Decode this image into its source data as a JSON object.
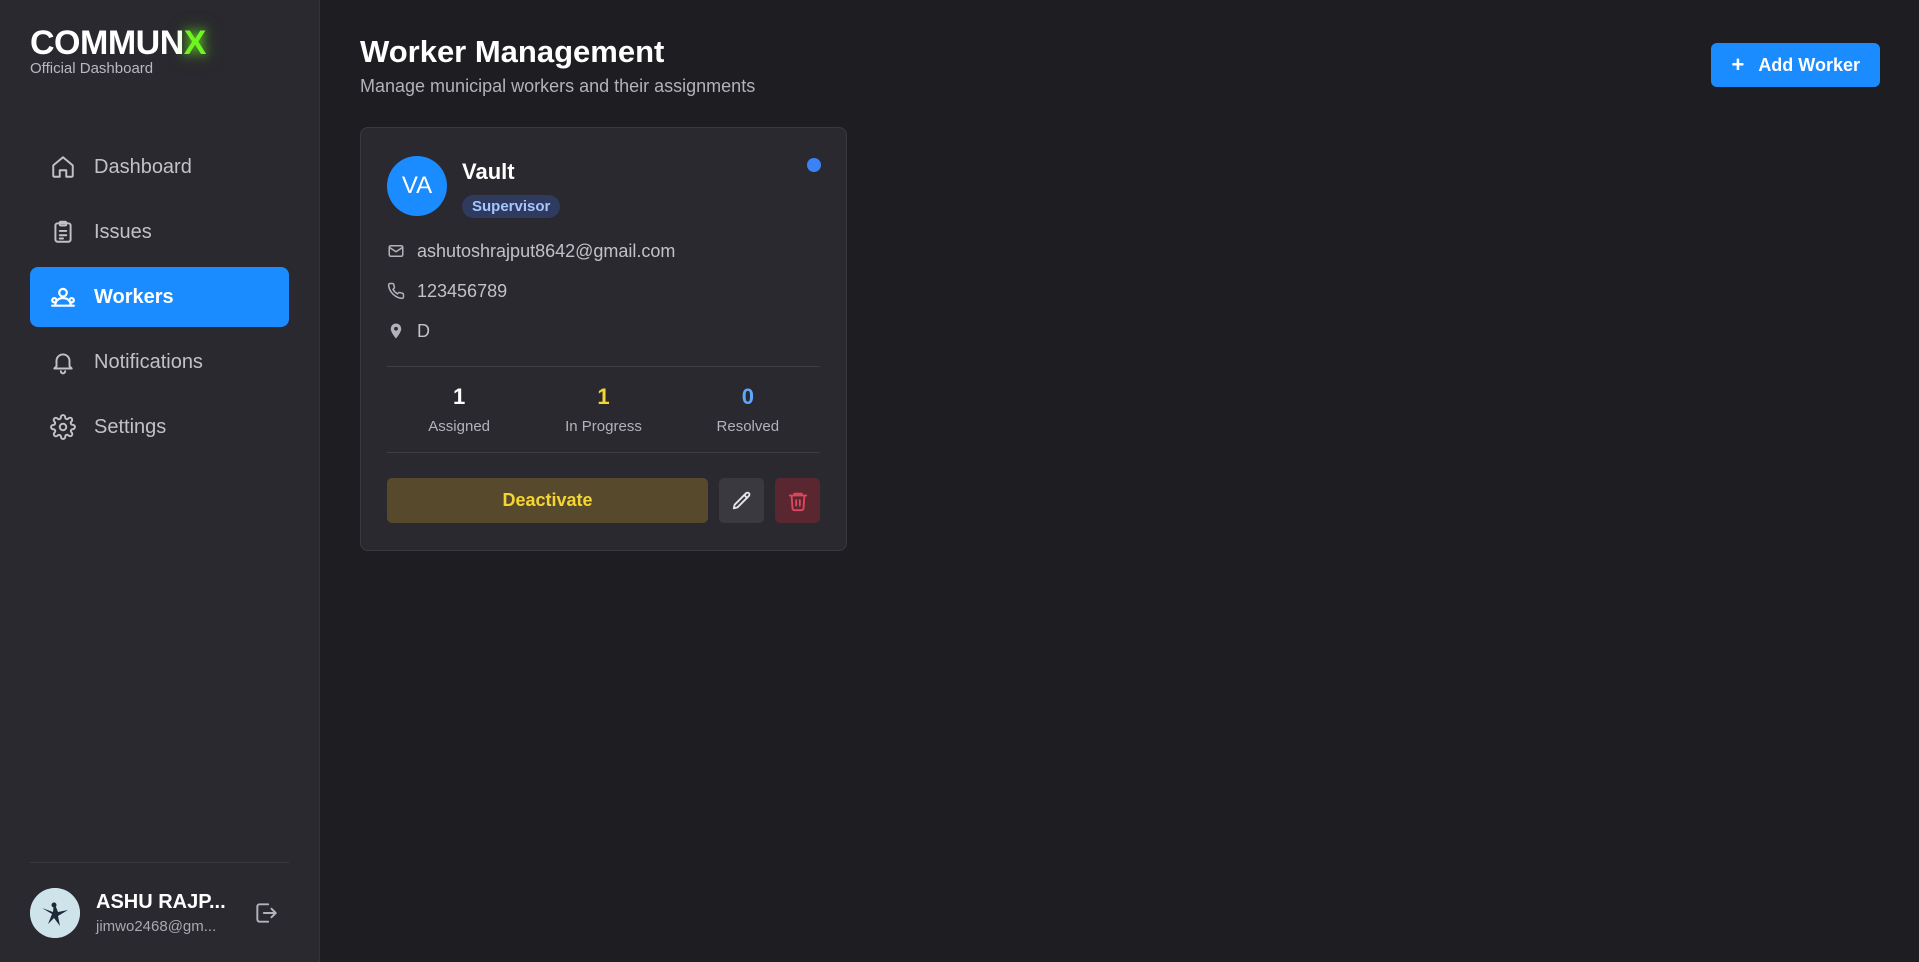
{
  "brand": {
    "name_main": "COMMUN",
    "name_accent": "X",
    "subtitle": "Official Dashboard",
    "accent_color": "#6ff51f"
  },
  "nav": {
    "items": [
      {
        "label": "Dashboard",
        "icon": "home-icon",
        "active": false
      },
      {
        "label": "Issues",
        "icon": "clipboard-icon",
        "active": false
      },
      {
        "label": "Workers",
        "icon": "users-icon",
        "active": true
      },
      {
        "label": "Notifications",
        "icon": "bell-icon",
        "active": false
      },
      {
        "label": "Settings",
        "icon": "gear-icon",
        "active": false
      }
    ]
  },
  "user": {
    "name": "ASHU RAJP...",
    "email": "jimwo2468@gm..."
  },
  "header": {
    "title": "Worker Management",
    "subtitle": "Manage municipal workers and their assignments",
    "add_button_label": "Add Worker"
  },
  "worker_card": {
    "initials": "VA",
    "name": "Vault",
    "role": "Supervisor",
    "email": "ashutoshrajput8642@gmail.com",
    "phone": "123456789",
    "location": "D",
    "status_color": "#3b82f6",
    "stats": {
      "assigned_value": "1",
      "assigned_label": "Assigned",
      "in_progress_value": "1",
      "in_progress_label": "In Progress",
      "resolved_value": "0",
      "resolved_label": "Resolved"
    },
    "deactivate_label": "Deactivate"
  },
  "colors": {
    "primary": "#1a8cff",
    "warning": "#f5d532",
    "danger": "#e0475e"
  }
}
